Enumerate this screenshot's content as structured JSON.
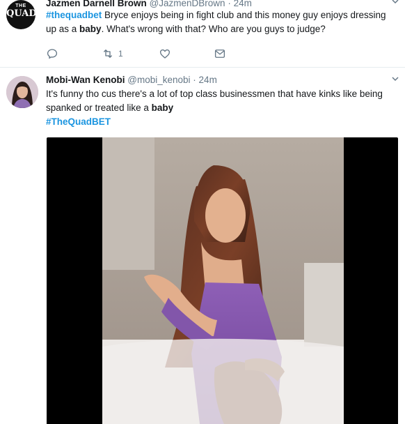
{
  "tweets": [
    {
      "name": "Jazmen Darnell Brown",
      "handle": "@JazmenDBrown",
      "separator": "·",
      "time": "24m",
      "avatar": {
        "logo_top": "THE",
        "logo_main": "QUAD"
      },
      "text": {
        "hashtag": "#thequadbet",
        "part1": " Bryce enjoys being in fight club and this money guy enjoys dressing up as a ",
        "bold_word": "baby",
        "part2": ". What's wrong with that? Who are you guys to judge?"
      },
      "retweet_count": "1"
    },
    {
      "name": "Mobi-Wan Kenobi",
      "handle": "@mobi_kenobi",
      "separator": "·",
      "time": "24m",
      "text": {
        "part1": "It's funny tho cus there's a lot of top class businessmen that have kinks like being spanked or treated like a ",
        "bold_word": "baby",
        "hashtag": "#TheQuadBET"
      }
    }
  ],
  "colors": {
    "link": "#1b95e0",
    "secondary_text": "#657786",
    "divider": "#e6ecf0"
  },
  "icons": [
    "chevron-down-icon",
    "reply-icon",
    "retweet-icon",
    "like-icon",
    "direct-message-icon"
  ]
}
